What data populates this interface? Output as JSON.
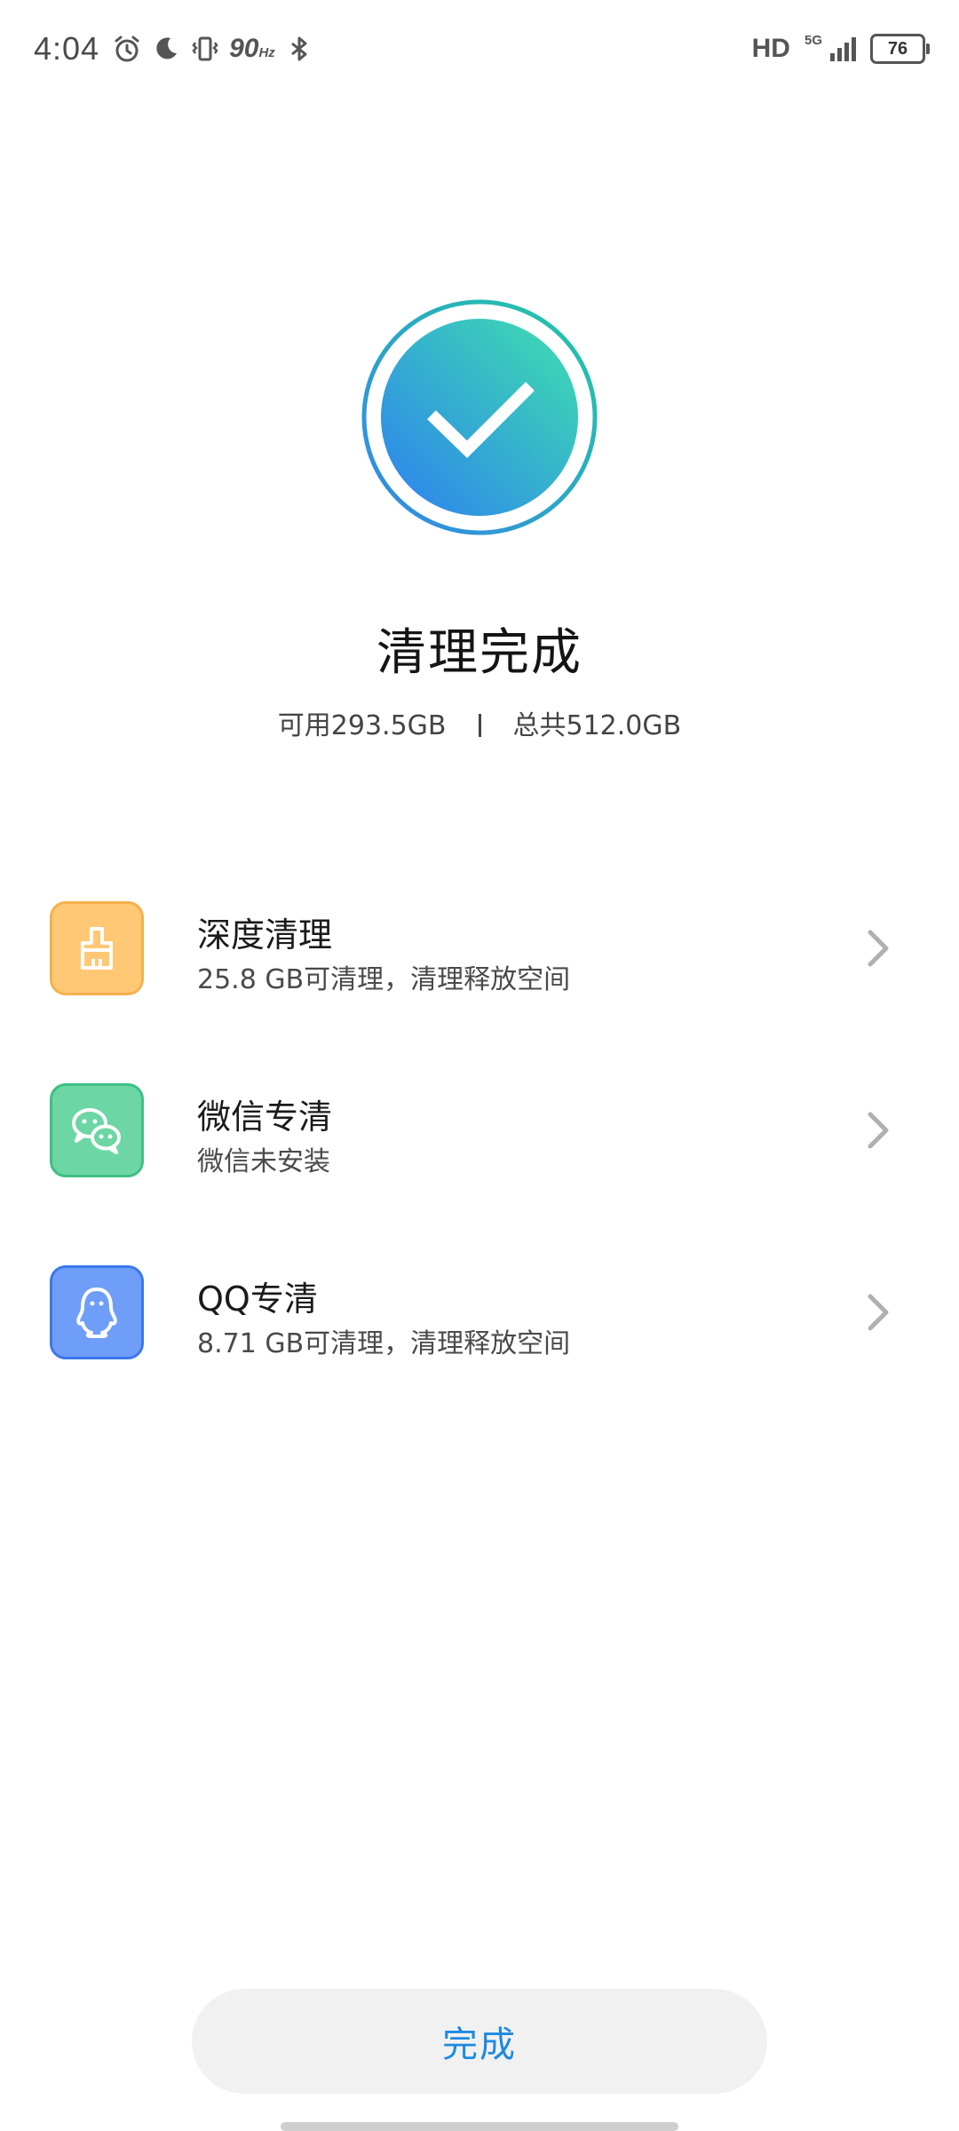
{
  "status_bar": {
    "time": "4:04",
    "refresh_rate": "90",
    "refresh_unit": "Hz",
    "hd_label": "HD",
    "network_label": "5G",
    "battery_level": "76",
    "icons": [
      "alarm-icon",
      "moon-icon",
      "vibrate-icon",
      "bluetooth-icon",
      "signal-icon",
      "battery-icon"
    ]
  },
  "result": {
    "title": "清理完成",
    "available": "可用293.5GB",
    "total": "总共512.0GB"
  },
  "items": [
    {
      "title": "深度清理",
      "subtitle": "25.8 GB可清理，清理释放空间",
      "icon": "brush-icon",
      "color": "#ffc874"
    },
    {
      "title": "微信专清",
      "subtitle": "微信未安装",
      "icon": "wechat-icon",
      "color": "#6cd6a4"
    },
    {
      "title": "QQ专清",
      "subtitle": "8.71 GB可清理，清理释放空间",
      "icon": "qq-icon",
      "color": "#6f9ef8"
    }
  ],
  "done_label": "完成",
  "colors": {
    "accent": "#1d8ae0",
    "check_gradient_start": "#36dcae",
    "check_gradient_end": "#2f86ee"
  }
}
